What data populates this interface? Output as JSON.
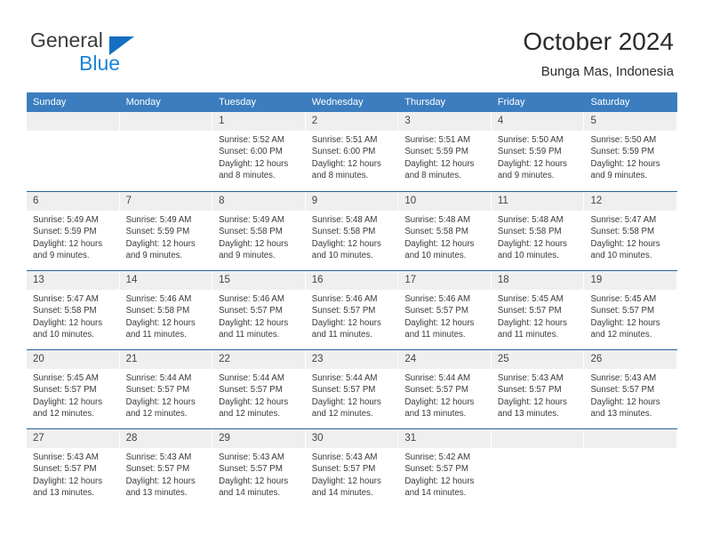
{
  "brand": {
    "name_part1": "General",
    "name_part2": "Blue",
    "triangle_color": "#176fc1",
    "blue_text_color": "#1c84d6"
  },
  "header": {
    "title": "October 2024",
    "subtitle": "Bunga Mas, Indonesia"
  },
  "theme": {
    "header_bar_color": "#3b7dbe",
    "week_divider_color": "#2a62a0",
    "day_band_color": "#efefef"
  },
  "calendar": {
    "weekday_headers": [
      "Sunday",
      "Monday",
      "Tuesday",
      "Wednesday",
      "Thursday",
      "Friday",
      "Saturday"
    ],
    "weeks": [
      [
        {
          "day": "",
          "lines": []
        },
        {
          "day": "",
          "lines": []
        },
        {
          "day": "1",
          "lines": [
            "Sunrise: 5:52 AM",
            "Sunset: 6:00 PM",
            "Daylight: 12 hours",
            "and 8 minutes."
          ]
        },
        {
          "day": "2",
          "lines": [
            "Sunrise: 5:51 AM",
            "Sunset: 6:00 PM",
            "Daylight: 12 hours",
            "and 8 minutes."
          ]
        },
        {
          "day": "3",
          "lines": [
            "Sunrise: 5:51 AM",
            "Sunset: 5:59 PM",
            "Daylight: 12 hours",
            "and 8 minutes."
          ]
        },
        {
          "day": "4",
          "lines": [
            "Sunrise: 5:50 AM",
            "Sunset: 5:59 PM",
            "Daylight: 12 hours",
            "and 9 minutes."
          ]
        },
        {
          "day": "5",
          "lines": [
            "Sunrise: 5:50 AM",
            "Sunset: 5:59 PM",
            "Daylight: 12 hours",
            "and 9 minutes."
          ]
        }
      ],
      [
        {
          "day": "6",
          "lines": [
            "Sunrise: 5:49 AM",
            "Sunset: 5:59 PM",
            "Daylight: 12 hours",
            "and 9 minutes."
          ]
        },
        {
          "day": "7",
          "lines": [
            "Sunrise: 5:49 AM",
            "Sunset: 5:59 PM",
            "Daylight: 12 hours",
            "and 9 minutes."
          ]
        },
        {
          "day": "8",
          "lines": [
            "Sunrise: 5:49 AM",
            "Sunset: 5:58 PM",
            "Daylight: 12 hours",
            "and 9 minutes."
          ]
        },
        {
          "day": "9",
          "lines": [
            "Sunrise: 5:48 AM",
            "Sunset: 5:58 PM",
            "Daylight: 12 hours",
            "and 10 minutes."
          ]
        },
        {
          "day": "10",
          "lines": [
            "Sunrise: 5:48 AM",
            "Sunset: 5:58 PM",
            "Daylight: 12 hours",
            "and 10 minutes."
          ]
        },
        {
          "day": "11",
          "lines": [
            "Sunrise: 5:48 AM",
            "Sunset: 5:58 PM",
            "Daylight: 12 hours",
            "and 10 minutes."
          ]
        },
        {
          "day": "12",
          "lines": [
            "Sunrise: 5:47 AM",
            "Sunset: 5:58 PM",
            "Daylight: 12 hours",
            "and 10 minutes."
          ]
        }
      ],
      [
        {
          "day": "13",
          "lines": [
            "Sunrise: 5:47 AM",
            "Sunset: 5:58 PM",
            "Daylight: 12 hours",
            "and 10 minutes."
          ]
        },
        {
          "day": "14",
          "lines": [
            "Sunrise: 5:46 AM",
            "Sunset: 5:58 PM",
            "Daylight: 12 hours",
            "and 11 minutes."
          ]
        },
        {
          "day": "15",
          "lines": [
            "Sunrise: 5:46 AM",
            "Sunset: 5:57 PM",
            "Daylight: 12 hours",
            "and 11 minutes."
          ]
        },
        {
          "day": "16",
          "lines": [
            "Sunrise: 5:46 AM",
            "Sunset: 5:57 PM",
            "Daylight: 12 hours",
            "and 11 minutes."
          ]
        },
        {
          "day": "17",
          "lines": [
            "Sunrise: 5:46 AM",
            "Sunset: 5:57 PM",
            "Daylight: 12 hours",
            "and 11 minutes."
          ]
        },
        {
          "day": "18",
          "lines": [
            "Sunrise: 5:45 AM",
            "Sunset: 5:57 PM",
            "Daylight: 12 hours",
            "and 11 minutes."
          ]
        },
        {
          "day": "19",
          "lines": [
            "Sunrise: 5:45 AM",
            "Sunset: 5:57 PM",
            "Daylight: 12 hours",
            "and 12 minutes."
          ]
        }
      ],
      [
        {
          "day": "20",
          "lines": [
            "Sunrise: 5:45 AM",
            "Sunset: 5:57 PM",
            "Daylight: 12 hours",
            "and 12 minutes."
          ]
        },
        {
          "day": "21",
          "lines": [
            "Sunrise: 5:44 AM",
            "Sunset: 5:57 PM",
            "Daylight: 12 hours",
            "and 12 minutes."
          ]
        },
        {
          "day": "22",
          "lines": [
            "Sunrise: 5:44 AM",
            "Sunset: 5:57 PM",
            "Daylight: 12 hours",
            "and 12 minutes."
          ]
        },
        {
          "day": "23",
          "lines": [
            "Sunrise: 5:44 AM",
            "Sunset: 5:57 PM",
            "Daylight: 12 hours",
            "and 12 minutes."
          ]
        },
        {
          "day": "24",
          "lines": [
            "Sunrise: 5:44 AM",
            "Sunset: 5:57 PM",
            "Daylight: 12 hours",
            "and 13 minutes."
          ]
        },
        {
          "day": "25",
          "lines": [
            "Sunrise: 5:43 AM",
            "Sunset: 5:57 PM",
            "Daylight: 12 hours",
            "and 13 minutes."
          ]
        },
        {
          "day": "26",
          "lines": [
            "Sunrise: 5:43 AM",
            "Sunset: 5:57 PM",
            "Daylight: 12 hours",
            "and 13 minutes."
          ]
        }
      ],
      [
        {
          "day": "27",
          "lines": [
            "Sunrise: 5:43 AM",
            "Sunset: 5:57 PM",
            "Daylight: 12 hours",
            "and 13 minutes."
          ]
        },
        {
          "day": "28",
          "lines": [
            "Sunrise: 5:43 AM",
            "Sunset: 5:57 PM",
            "Daylight: 12 hours",
            "and 13 minutes."
          ]
        },
        {
          "day": "29",
          "lines": [
            "Sunrise: 5:43 AM",
            "Sunset: 5:57 PM",
            "Daylight: 12 hours",
            "and 14 minutes."
          ]
        },
        {
          "day": "30",
          "lines": [
            "Sunrise: 5:43 AM",
            "Sunset: 5:57 PM",
            "Daylight: 12 hours",
            "and 14 minutes."
          ]
        },
        {
          "day": "31",
          "lines": [
            "Sunrise: 5:42 AM",
            "Sunset: 5:57 PM",
            "Daylight: 12 hours",
            "and 14 minutes."
          ]
        },
        {
          "day": "",
          "lines": []
        },
        {
          "day": "",
          "lines": []
        }
      ]
    ]
  }
}
